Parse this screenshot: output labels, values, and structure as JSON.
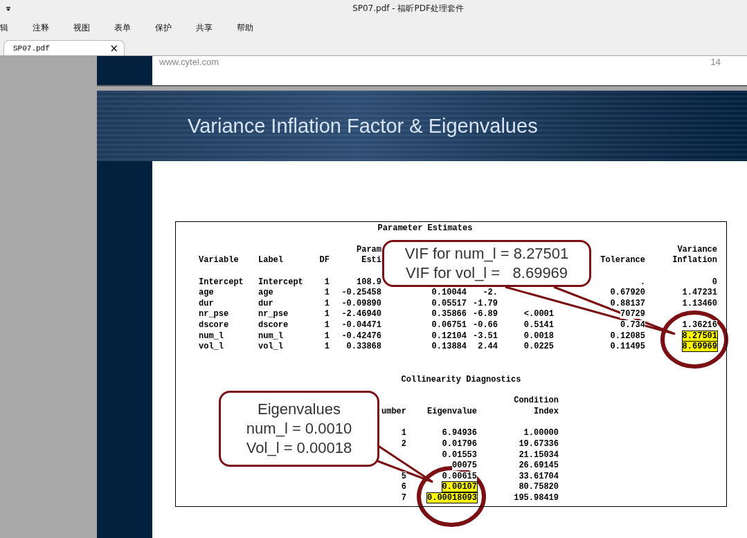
{
  "window": {
    "title": "SP07.pdf - 福昕PDF处理套件"
  },
  "menu": [
    {
      "label": "辑"
    },
    {
      "label": "注释"
    },
    {
      "label": "视图"
    },
    {
      "label": "表单"
    },
    {
      "label": "保护"
    },
    {
      "label": "共享"
    },
    {
      "label": "帮助"
    }
  ],
  "tabs": [
    {
      "label": "SP07.pdf",
      "selected": true,
      "close": "×"
    }
  ],
  "previous_page": {
    "footer_url": "www.cytel.com",
    "page_number": "14"
  },
  "slide": {
    "title": "Variance Inflation Factor & Eigenvalues",
    "tables": [
      {
        "kind": "parameter",
        "title": "Parameter Estimates",
        "columns": [
          {
            "lines": [
              "Variable"
            ]
          },
          {
            "lines": [
              "Label"
            ]
          },
          {
            "lines": [
              "DF"
            ]
          },
          {
            "lines": [
              "Param",
              "Esti"
            ]
          },
          null,
          null,
          null,
          {
            "lines": [
              "Tolerance"
            ]
          },
          {
            "lines": [
              "Variance",
              "Inflation"
            ]
          }
        ],
        "rows": [
          {
            "cells": [
              "Intercept",
              "Intercept",
              "1",
              "108.9",
              null,
              null,
              null,
              ".",
              "0"
            ],
            "highlighted": false
          },
          {
            "cells": [
              "age",
              "age",
              "1",
              "-0.25458",
              "0.10044",
              "-2.",
              null,
              "0.67920",
              "1.47231"
            ],
            "highlighted": false
          },
          {
            "cells": [
              "dur",
              "dur",
              "1",
              "-0.09890",
              "0.05517",
              "-1.79",
              null,
              "0.88137",
              "1.13460"
            ],
            "highlighted": false
          },
          {
            "cells": [
              "nr_pse",
              "nr_pse",
              "1",
              "-2.46940",
              "0.35866",
              "-6.89",
              "<.0001",
              "70729",
              null
            ],
            "highlighted": false
          },
          {
            "cells": [
              "dscore",
              "dscore",
              "1",
              "-0.04471",
              "0.06751",
              "-0.66",
              "0.5141",
              "0.734",
              "1.36216"
            ],
            "highlighted": false
          },
          {
            "cells": [
              "num_l",
              "num_l",
              "1",
              "-0.42476",
              "0.12104",
              "-3.51",
              "0.0018",
              "0.12085",
              "8.27501"
            ],
            "highlighted": true
          },
          {
            "cells": [
              "vol_l",
              "vol_l",
              "1",
              "0.33868",
              "0.13884",
              "2.44",
              "0.0225",
              "0.11495",
              "8.69969"
            ],
            "highlighted": true
          }
        ]
      },
      {
        "kind": "collinearity",
        "title": "Collinearity Diagnostics",
        "columns": [
          {
            "lines": [
              "umber"
            ]
          },
          {
            "lines": [
              "Eigenvalue"
            ]
          },
          {
            "lines": [
              "Condition",
              "Index"
            ]
          }
        ],
        "rows": [
          {
            "cells": [
              "1",
              "6.94936",
              "1.00000"
            ],
            "highlighted": false
          },
          {
            "cells": [
              "2",
              "0.01796",
              "19.67336"
            ],
            "highlighted": false
          },
          {
            "cells": [
              null,
              "0.01553",
              "21.15034"
            ],
            "highlighted": false
          },
          {
            "cells": [
              null,
              "00075",
              "26.69145"
            ],
            "highlighted": false
          },
          {
            "cells": [
              "5",
              "0.00615",
              "33.61704"
            ],
            "highlighted": false
          },
          {
            "cells": [
              "6",
              "0.00107",
              "80.75820"
            ],
            "highlighted": true
          },
          {
            "cells": [
              "7",
              "0.00018093",
              "195.98419"
            ],
            "highlighted": true
          }
        ]
      }
    ],
    "callouts": [
      {
        "kind": "vif",
        "lines": [
          "VIF for num_l = 8.27501",
          "VIF for vol_l =   8.69969"
        ]
      },
      {
        "kind": "eigen",
        "lines": [
          "Eigenvalues",
          "num_l = 0.0010",
          "Vol_l = 0.00018"
        ]
      }
    ]
  }
}
